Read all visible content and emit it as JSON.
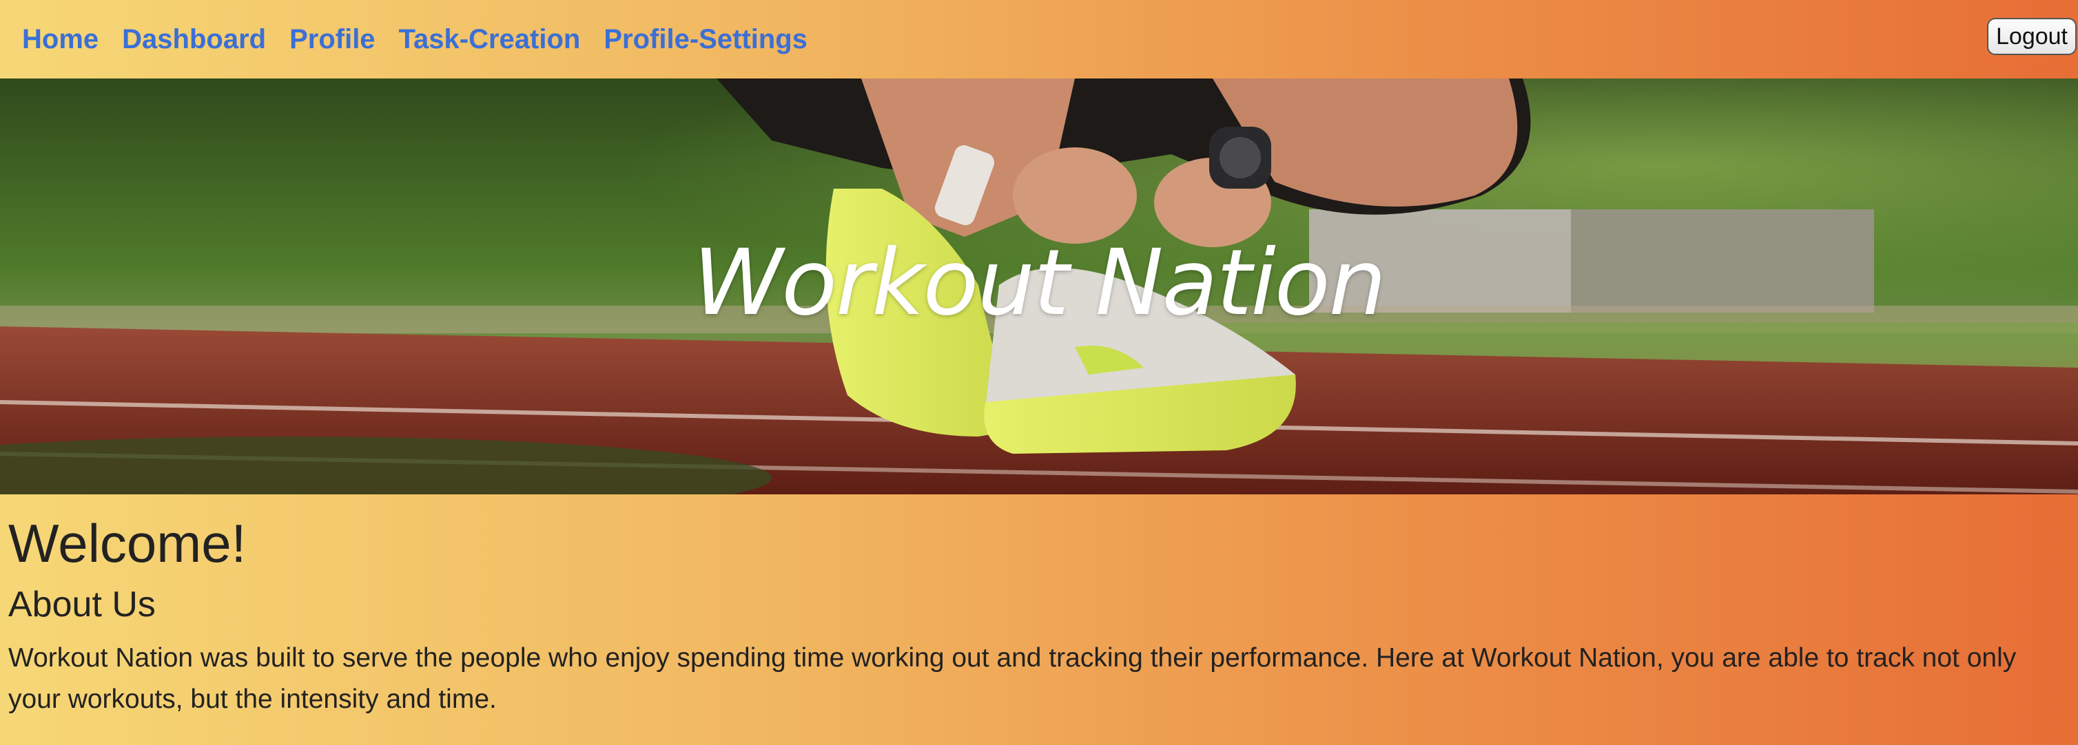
{
  "nav": {
    "links": [
      "Home",
      "Dashboard",
      "Profile",
      "Task-Creation",
      "Profile-Settings"
    ],
    "logout_label": "Logout"
  },
  "hero": {
    "title": "Workout Nation",
    "image": "runner-lacing-shoes-on-track"
  },
  "main": {
    "welcome": "Welcome!",
    "about_heading": "About Us",
    "about_text": "Workout Nation was built to serve the people who enjoy spending time working out and tracking their performance. Here at Workout Nation, you are able to track not only your workouts, but the intensity and time."
  },
  "colors": {
    "gradient_start": "#f6d776",
    "gradient_end": "#e76e36",
    "link": "#3b6fd6"
  }
}
